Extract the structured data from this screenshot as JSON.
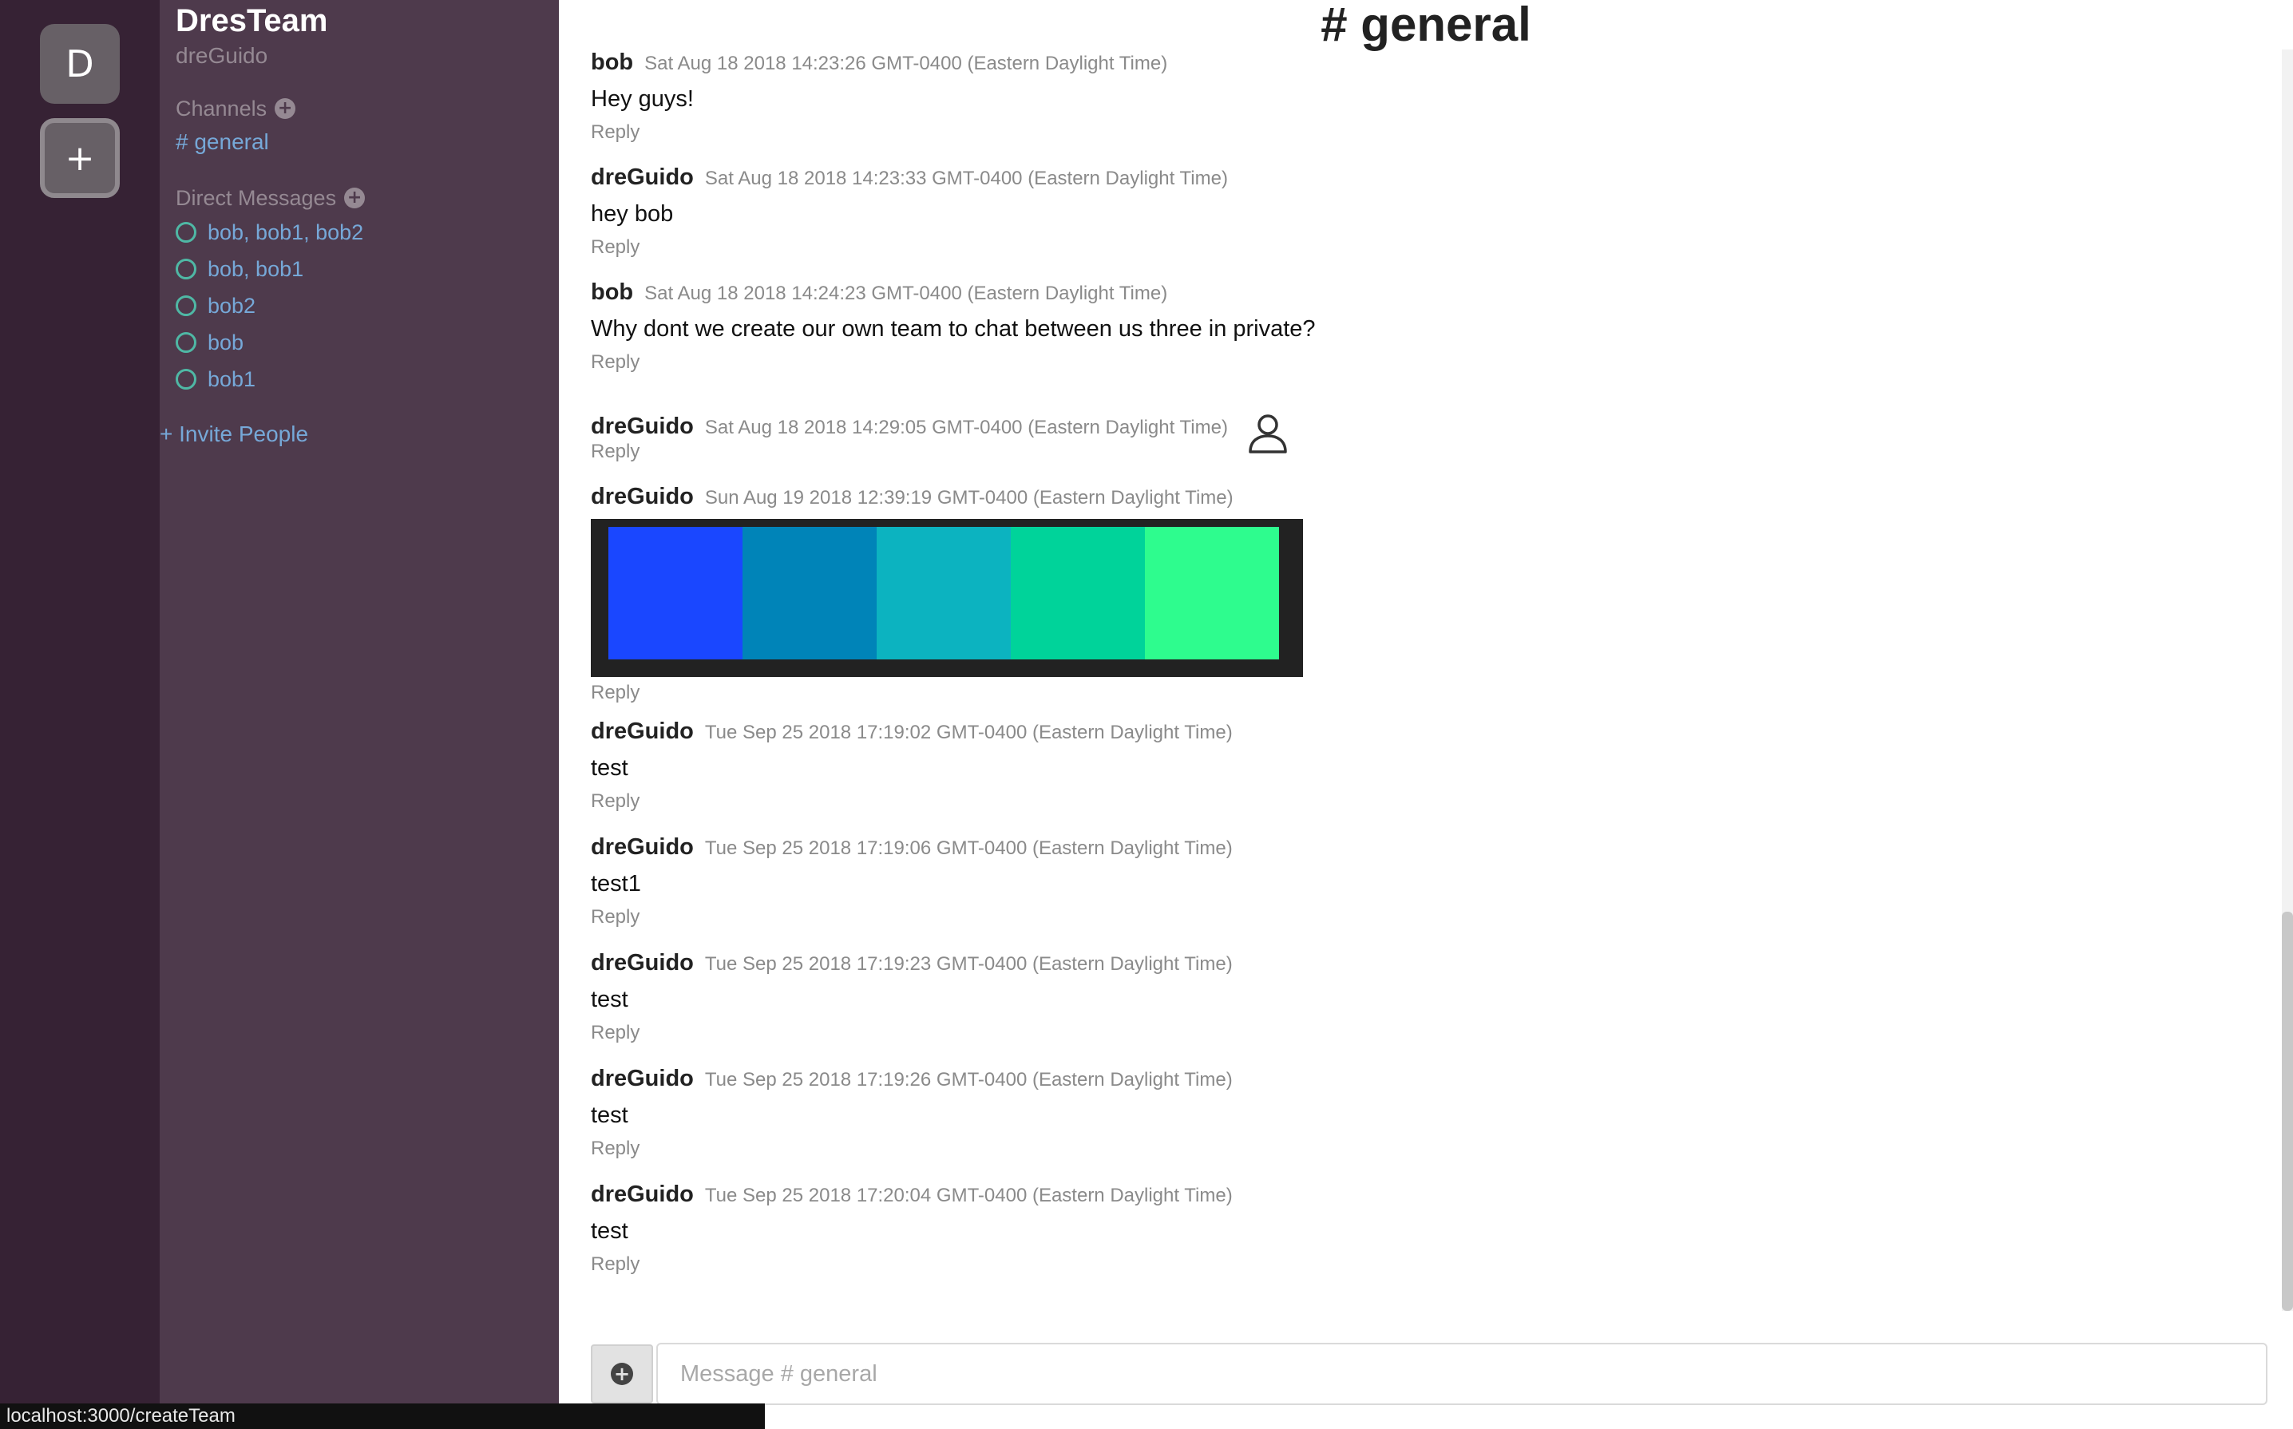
{
  "team_bar": {
    "team_initial": "D",
    "add_team_label": "+"
  },
  "sidebar": {
    "team_name": "DresTeam",
    "username": "dreGuido",
    "channels_heading": "Channels",
    "channels": [
      {
        "label": "# general"
      }
    ],
    "dm_heading": "Direct Messages",
    "direct_messages": [
      {
        "label": "bob, bob1, bob2"
      },
      {
        "label": "bob, bob1"
      },
      {
        "label": "bob2"
      },
      {
        "label": "bob"
      },
      {
        "label": "bob1"
      }
    ],
    "invite_label": "+ Invite People",
    "colors": {
      "background": "#4e3a4c",
      "link": "#76a8d8",
      "presence": "#4fb8a5"
    }
  },
  "header": {
    "channel_title": "# general"
  },
  "messages": [
    {
      "author": "bob",
      "time": "Sat Aug 18 2018 14:23:26 GMT-0400 (Eastern Daylight Time)",
      "text": "Hey guys!",
      "reply": "Reply"
    },
    {
      "author": "dreGuido",
      "time": "Sat Aug 18 2018 14:23:33 GMT-0400 (Eastern Daylight Time)",
      "text": "hey bob",
      "reply": "Reply"
    },
    {
      "author": "bob",
      "time": "Sat Aug 18 2018 14:24:23 GMT-0400 (Eastern Daylight Time)",
      "text": "Why dont we create our own team to chat between us three in private?",
      "reply": "Reply"
    },
    {
      "author": "dreGuido",
      "time": "Sat Aug 18 2018 14:29:05 GMT-0400 (Eastern Daylight Time)",
      "text": "",
      "reply": "Reply",
      "attachment_icon": "user-icon"
    },
    {
      "author": "dreGuido",
      "time": "Sun Aug 19 2018 12:39:19 GMT-0400 (Eastern Daylight Time)",
      "text": "",
      "reply": "Reply",
      "image_colors": [
        "#1a47ff",
        "#0084b8",
        "#0cb3c0",
        "#00d39a",
        "#2efc8e"
      ]
    },
    {
      "author": "dreGuido",
      "time": "Tue Sep 25 2018 17:19:02 GMT-0400 (Eastern Daylight Time)",
      "text": "test",
      "reply": "Reply"
    },
    {
      "author": "dreGuido",
      "time": "Tue Sep 25 2018 17:19:06 GMT-0400 (Eastern Daylight Time)",
      "text": "test1",
      "reply": "Reply"
    },
    {
      "author": "dreGuido",
      "time": "Tue Sep 25 2018 17:19:23 GMT-0400 (Eastern Daylight Time)",
      "text": "test",
      "reply": "Reply"
    },
    {
      "author": "dreGuido",
      "time": "Tue Sep 25 2018 17:19:26 GMT-0400 (Eastern Daylight Time)",
      "text": "test",
      "reply": "Reply"
    },
    {
      "author": "dreGuido",
      "time": "Tue Sep 25 2018 17:20:04 GMT-0400 (Eastern Daylight Time)",
      "text": "test",
      "reply": "Reply"
    }
  ],
  "composer": {
    "placeholder": "Message # general",
    "attach_icon": "plus-circle-icon"
  },
  "status_bar": {
    "url": "localhost:3000/createTeam"
  }
}
